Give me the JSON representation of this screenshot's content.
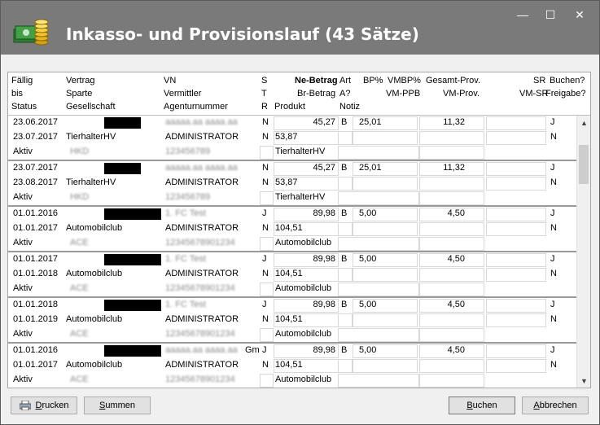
{
  "window": {
    "title": "Inkasso- und Provisionslauf (43 Sätze)"
  },
  "window_buttons": {
    "minimize": "—",
    "maximize": "☐",
    "close": "✕"
  },
  "header": {
    "col1": [
      "Fällig",
      "bis",
      "Status"
    ],
    "col2": [
      "Vertrag",
      "Sparte",
      "Gesellschaft"
    ],
    "col3": [
      "VN",
      "Vermittler",
      "Agenturnummer"
    ],
    "col4": [
      "S",
      "T",
      "R"
    ],
    "ne_betrag": "Ne-Betrag",
    "br_betrag": "Br-Betrag",
    "produkt": "Produkt",
    "art": "Art",
    "a": "A?",
    "notiz": "Notiz",
    "bp": "BP%",
    "vmbp": "VMBP%",
    "vm_ppb": "VM-PPB",
    "gesamt_prov": "Gesamt-Prov.",
    "vm_prov": "VM-Prov.",
    "sr": "SR",
    "vm_sr": "VM-SR",
    "buchen": "Buchen?",
    "freigabe": "Freigabe?"
  },
  "records": [
    {
      "l1": {
        "date": "23.06.2017",
        "vn": "aaaaa.aa aaaa.aa",
        "s": "N",
        "ne": "45,27",
        "art": "B",
        "bp": "25,01",
        "gp": "11,32",
        "flag": "J"
      },
      "l2": {
        "date": "23.07.2017",
        "sparte": "TierhalterHV",
        "verm": "ADMINISTRATOR",
        "s": "N",
        "br": "53,87",
        "flag": "N"
      },
      "l3": {
        "status": "Aktiv",
        "ges": "HKD",
        "agn": "123456789",
        "produkt": "TierhalterHV"
      }
    },
    {
      "l1": {
        "date": "23.07.2017",
        "vn": "aaaaa.aa aaaa.aa",
        "s": "N",
        "ne": "45,27",
        "art": "B",
        "bp": "25,01",
        "gp": "11,32",
        "flag": "J"
      },
      "l2": {
        "date": "23.08.2017",
        "sparte": "TierhalterHV",
        "verm": "ADMINISTRATOR",
        "s": "N",
        "br": "53,87",
        "flag": "N"
      },
      "l3": {
        "status": "Aktiv",
        "ges": "HKD",
        "agn": "123456789",
        "produkt": "TierhalterHV"
      }
    },
    {
      "l1": {
        "date": "01.01.2016",
        "vn": "1. FC Test",
        "s": "J",
        "ne": "89,98",
        "art": "B",
        "bp": "5,00",
        "gp": "4,50",
        "flag": "J"
      },
      "l2": {
        "date": "01.01.2017",
        "sparte": "Automobilclub",
        "verm": "ADMINISTRATOR",
        "s": "N",
        "br": "104,51",
        "flag": "N"
      },
      "l3": {
        "status": "Aktiv",
        "ges": "ACE",
        "agn": "12345678901234",
        "produkt": "Automobilclub"
      }
    },
    {
      "l1": {
        "date": "01.01.2017",
        "vn": "1. FC Test",
        "s": "J",
        "ne": "89,98",
        "art": "B",
        "bp": "5,00",
        "gp": "4,50",
        "flag": "J"
      },
      "l2": {
        "date": "01.01.2018",
        "sparte": "Automobilclub",
        "verm": "ADMINISTRATOR",
        "s": "N",
        "br": "104,51",
        "flag": "N"
      },
      "l3": {
        "status": "Aktiv",
        "ges": "ACE",
        "agn": "12345678901234",
        "produkt": "Automobilclub"
      }
    },
    {
      "l1": {
        "date": "01.01.2018",
        "vn": "1. FC Test",
        "s": "J",
        "ne": "89,98",
        "art": "B",
        "bp": "5,00",
        "gp": "4,50",
        "flag": "J"
      },
      "l2": {
        "date": "01.01.2019",
        "sparte": "Automobilclub",
        "verm": "ADMINISTRATOR",
        "s": "N",
        "br": "104,51",
        "flag": "N"
      },
      "l3": {
        "status": "Aktiv",
        "ges": "ACE",
        "agn": "12345678901234",
        "produkt": "Automobilclub"
      }
    },
    {
      "l1": {
        "date": "01.01.2016",
        "vn": "aaaaa.aa aaaa.aa",
        "vn_suffix": "Gm",
        "s": "J",
        "ne": "89,98",
        "art": "B",
        "bp": "5,00",
        "gp": "4,50",
        "flag": "J"
      },
      "l2": {
        "date": "01.01.2017",
        "sparte": "Automobilclub",
        "verm": "ADMINISTRATOR",
        "s": "N",
        "br": "104,51",
        "flag": "N"
      },
      "l3": {
        "status": "Aktiv",
        "ges": "ACE",
        "agn": "12345678901234",
        "produkt": "Automobilclub"
      }
    }
  ],
  "footer": {
    "drucken": "Drucken",
    "summen": "Summen",
    "buchen": "Buchen",
    "abbrechen": "Abbrechen"
  }
}
